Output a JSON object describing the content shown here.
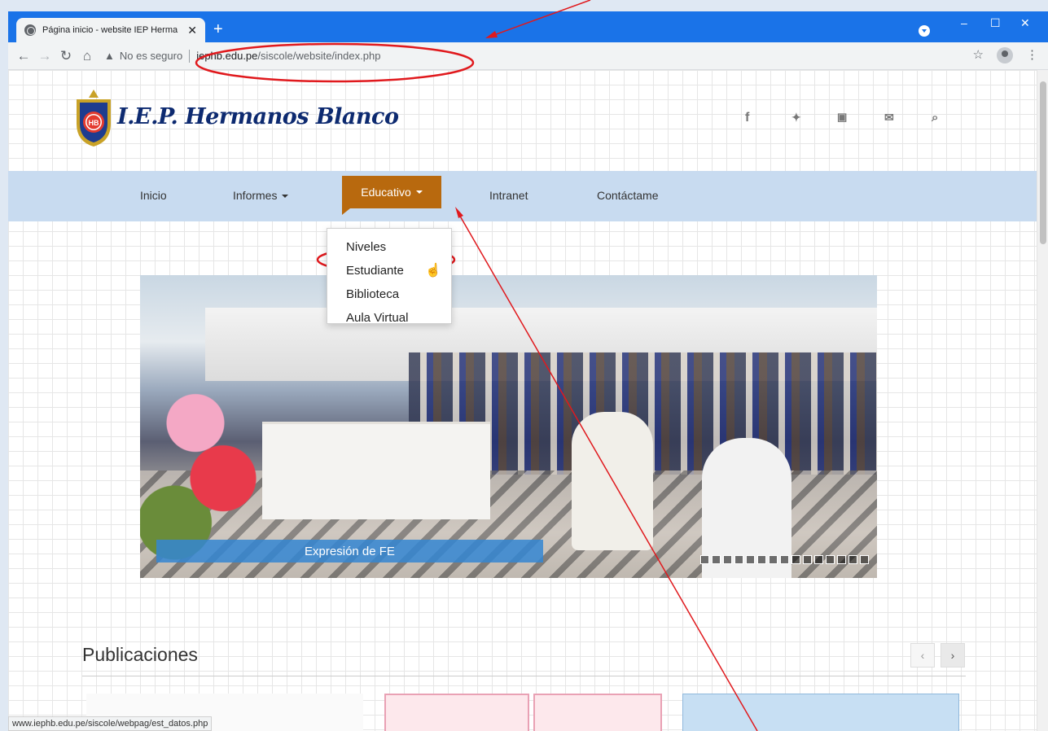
{
  "browser": {
    "tab_title": "Página inicio - website IEP Herma",
    "not_secure": "No es seguro",
    "url_domain": "iephb.edu.pe",
    "url_path": "/siscole/website/index.php",
    "status_url": "www.iephb.edu.pe/siscole/webpag/est_datos.php"
  },
  "site": {
    "brand": "I.E.P. Hermanos Blanco",
    "logo_text": "HB"
  },
  "nav": {
    "items": [
      "Inicio",
      "Informes",
      "Educativo",
      "Intranet",
      "Contáctame"
    ],
    "active_index": 2
  },
  "dropdown": {
    "items": [
      "Niveles",
      "Estudiante",
      "Biblioteca",
      "Aula Virtual"
    ],
    "highlighted_index": 1
  },
  "slider": {
    "caption": "Expresión de FE",
    "dot_count": 15
  },
  "publicaciones": {
    "title": "Publicaciones"
  },
  "colors": {
    "titlebar": "#1a73e8",
    "nav_bg": "#c8dbf0",
    "nav_active": "#b8690e",
    "annotation": "#e0191d"
  }
}
